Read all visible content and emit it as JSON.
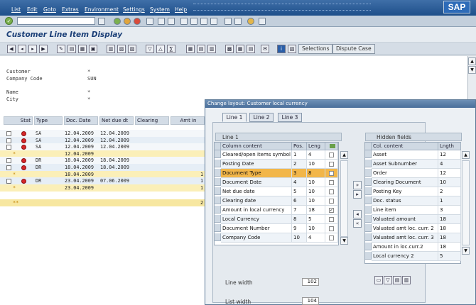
{
  "menu": [
    "List",
    "Edit",
    "Goto",
    "Extras",
    "Environment",
    "Settings",
    "System",
    "Help"
  ],
  "logo": "SAP",
  "title": "Customer Line Item Display",
  "toolbar": {
    "selections": "Selections",
    "dispute_case": "Dispute Case"
  },
  "header_info": [
    {
      "label": "Customer",
      "value": "*"
    },
    {
      "label": "Company Code",
      "value": "SUN"
    },
    {
      "label": "Name",
      "value": "*"
    },
    {
      "label": "City",
      "value": "*"
    }
  ],
  "grid": {
    "columns": [
      "Stat",
      "Type",
      "Doc. Date",
      "Net due dt",
      "Clearing",
      "Amt in"
    ],
    "rows": [
      {
        "check": true,
        "stat": "red",
        "type": "SA",
        "doc_date": "12.04.2009",
        "net_due": "12.04.2009",
        "amt": "",
        "sum": false
      },
      {
        "check": true,
        "stat": "red",
        "type": "SA",
        "doc_date": "12.04.2009",
        "net_due": "12.04.2009",
        "amt": "",
        "sum": false
      },
      {
        "check": true,
        "stat": "red",
        "type": "SA",
        "doc_date": "12.04.2009",
        "net_due": "12.04.2009",
        "amt": "",
        "sum": false
      },
      {
        "check": false,
        "stat": "*",
        "type": "",
        "doc_date": "12.04.2009",
        "net_due": "",
        "amt": "",
        "sum": true
      },
      {
        "check": true,
        "stat": "red",
        "type": "DR",
        "doc_date": "18.04.2009",
        "net_due": "18.04.2009",
        "amt": "",
        "sum": false
      },
      {
        "check": true,
        "stat": "red",
        "type": "DR",
        "doc_date": "18.04.2009",
        "net_due": "18.04.2009",
        "amt": "",
        "sum": false
      },
      {
        "check": false,
        "stat": "*",
        "type": "",
        "doc_date": "18.04.2009",
        "net_due": "",
        "amt": "1",
        "sum": true
      },
      {
        "check": true,
        "stat": "red",
        "type": "DR",
        "doc_date": "23.04.2009",
        "net_due": "07.06.2009",
        "amt": "1",
        "sum": false
      },
      {
        "check": false,
        "stat": "*",
        "type": "",
        "doc_date": "23.04.2009",
        "net_due": "",
        "amt": "1",
        "sum": true
      }
    ],
    "total_row": {
      "stat": "**",
      "amt": "2"
    }
  },
  "dialog": {
    "title": "Change layout: Customer local currency",
    "tabs": [
      "Line 1",
      "Line 2",
      "Line 3"
    ],
    "line_box_label": "Line 1",
    "displayed_headers": [
      "Column content",
      "Pos.",
      "Leng"
    ],
    "displayed_rows": [
      {
        "name": "Cleared/open items symbol",
        "pos": "1",
        "len": "4",
        "check": false
      },
      {
        "name": "Posting Date",
        "pos": "2",
        "len": "10",
        "check": false
      },
      {
        "name": "Document Type",
        "pos": "3",
        "len": "8",
        "check": false
      },
      {
        "name": "Document Date",
        "pos": "4",
        "len": "10",
        "check": false
      },
      {
        "name": "Net due date",
        "pos": "5",
        "len": "10",
        "check": false
      },
      {
        "name": "Clearing date",
        "pos": "6",
        "len": "10",
        "check": false
      },
      {
        "name": "Amount in local currency",
        "pos": "7",
        "len": "18",
        "check": true
      },
      {
        "name": "Local Currency",
        "pos": "8",
        "len": "5",
        "check": false
      },
      {
        "name": "Document Number",
        "pos": "9",
        "len": "10",
        "check": false
      },
      {
        "name": "Company Code",
        "pos": "10",
        "len": "4",
        "check": false
      }
    ],
    "hidden_label": "Hidden fields",
    "hidden_headers": [
      "Col. content",
      "Lngth"
    ],
    "hidden_rows": [
      {
        "name": "Asset",
        "len": "12"
      },
      {
        "name": "Asset Subnumber",
        "len": "4"
      },
      {
        "name": "Order",
        "len": "12"
      },
      {
        "name": "Clearing Document",
        "len": "10"
      },
      {
        "name": "Posting Key",
        "len": "2"
      },
      {
        "name": "Doc. status",
        "len": "1"
      },
      {
        "name": "Line item",
        "len": "3"
      },
      {
        "name": "Valuated amount",
        "len": "18"
      },
      {
        "name": "Valuated amt loc. curr. 2",
        "len": "18"
      },
      {
        "name": "Valuated amt loc. curr. 3",
        "len": "18"
      },
      {
        "name": "Amount in loc.curr.2",
        "len": "18"
      },
      {
        "name": "Local currency 2",
        "len": "5"
      }
    ],
    "line_width_label": "Line width",
    "line_width_value": "102",
    "list_width_label": "List width",
    "list_width_value": "104"
  }
}
